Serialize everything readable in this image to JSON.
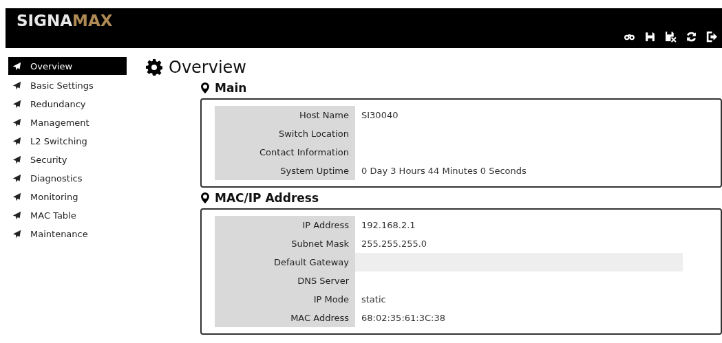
{
  "header": {
    "logo": [
      "SIGNA",
      "MAX"
    ],
    "toolbar": [
      {
        "kind": "glasses"
      },
      {
        "kind": "save"
      },
      {
        "kind": "discard"
      },
      {
        "kind": "refresh"
      },
      {
        "kind": "logout"
      }
    ]
  },
  "sidebar": {
    "items": [
      {
        "label": "Overview",
        "selected": true
      },
      {
        "label": "Basic Settings",
        "selected": false
      },
      {
        "label": "Redundancy",
        "selected": false
      },
      {
        "label": "Management",
        "selected": false
      },
      {
        "label": "L2 Switching",
        "selected": false
      },
      {
        "label": "Security",
        "selected": false
      },
      {
        "label": "Diagnostics",
        "selected": false
      },
      {
        "label": "Monitoring",
        "selected": false
      },
      {
        "label": "MAC Table",
        "selected": false
      },
      {
        "label": "Maintenance",
        "selected": false
      }
    ]
  },
  "page": {
    "title": "Overview",
    "sections": [
      {
        "title": "Main",
        "rows": [
          {
            "label": "Host Name",
            "value": "SI30040",
            "highlighted": false
          },
          {
            "label": "Switch Location",
            "highlighted": false
          },
          {
            "label": "Contact Information",
            "highlighted": false
          },
          {
            "label": "System Uptime",
            "value": "0 Day 3 Hours 44 Minutes 0 Seconds",
            "highlighted": false
          }
        ]
      },
      {
        "title": "MAC/IP Address",
        "rows": [
          {
            "label": "IP Address",
            "value": "192.168.2.1",
            "highlighted": false
          },
          {
            "label": "Subnet Mask",
            "value": "255.255.255.0",
            "highlighted": false
          },
          {
            "label": "Default Gateway",
            "highlighted": true
          },
          {
            "label": "DNS Server",
            "highlighted": false
          },
          {
            "label": "IP Mode",
            "value": "static",
            "highlighted": false
          },
          {
            "label": "MAC Address",
            "value": "68:02:35:61:3C:38",
            "highlighted": false
          }
        ]
      }
    ]
  }
}
